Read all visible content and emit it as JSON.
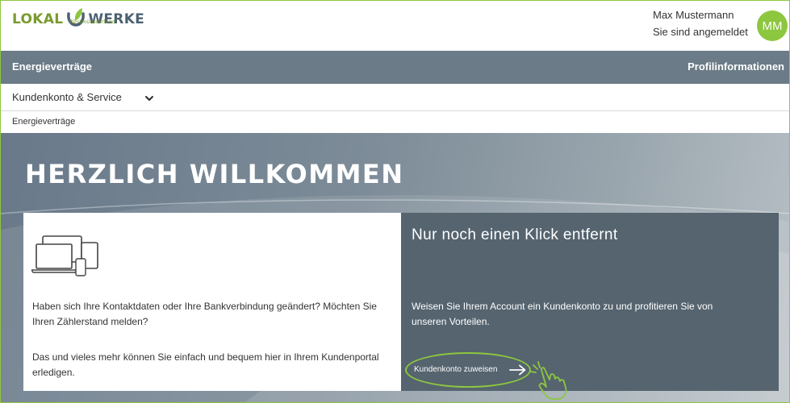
{
  "header": {
    "logo_part1": "LOKAL",
    "logo_part2": "WERKE",
    "logo_sub": "Westmünsterland",
    "user_name": "Max Mustermann",
    "user_status": "Sie sind angemeldet",
    "avatar_initials": "MM"
  },
  "navbar": {
    "left": "Energieverträge",
    "right": "Profilinformationen"
  },
  "submenu": {
    "label": "Kundenkonto & Service"
  },
  "breadcrumb": {
    "label": "Energieverträge"
  },
  "hero": {
    "title": "HERZLICH WILLKOMMEN"
  },
  "card_left": {
    "p1": "Haben sich Ihre Kontaktdaten oder Ihre Bankverbindung geändert? Möchten Sie Ihren Zählerstand melden?",
    "p2": "Das und vieles mehr können Sie einfach und bequem hier in Ihrem Kundenportal erledigen."
  },
  "card_right": {
    "title": "Nur noch einen Klick entfernt",
    "text": "Weisen Sie Ihrem Account ein Kundenkonto zu und profitieren Sie von unseren Vorteilen.",
    "cta_label": "Kundenkonto zuweisen"
  },
  "icons": {
    "logo": "plug-leaf-icon",
    "chevron": "chevron-down-icon",
    "devices": "devices-icon",
    "arrow": "arrow-right-icon",
    "hand": "pointer-hand-icon"
  },
  "colors": {
    "brand_green": "#8dc63f",
    "nav_gray": "#6b7b87",
    "card_dark": "#55646f"
  }
}
